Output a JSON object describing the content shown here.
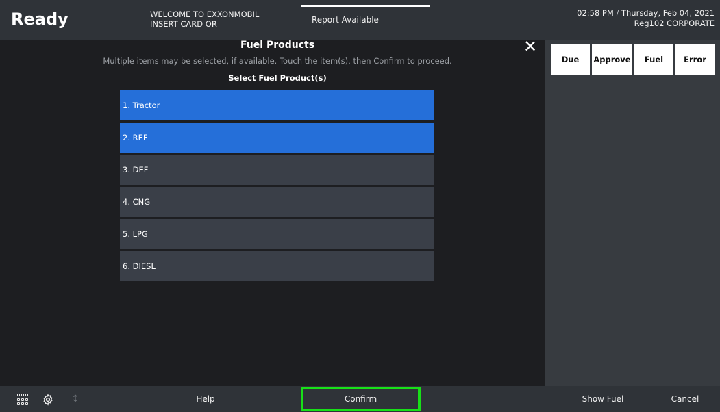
{
  "header": {
    "status": "Ready",
    "welcome_line1": "WELCOME TO EXXONMOBIL",
    "welcome_line2": "INSERT CARD OR",
    "report": "Report Available",
    "time": "02:58 PM",
    "separator": "/",
    "date": "Thursday, Feb 04, 2021",
    "register": "Reg102",
    "store": "CORPORATE"
  },
  "dialog": {
    "title": "Fuel Products",
    "subtitle": "Multiple items may be selected, if available. Touch the item(s), then Confirm to proceed.",
    "list_title": "Select Fuel Product(s)",
    "close_icon": "close-icon",
    "items": [
      {
        "label": "1. Tractor",
        "selected": true
      },
      {
        "label": "2. REF",
        "selected": true
      },
      {
        "label": "3. DEF",
        "selected": false
      },
      {
        "label": "4. CNG",
        "selected": false
      },
      {
        "label": "5. LPG",
        "selected": false
      },
      {
        "label": "6. DIESL",
        "selected": false
      }
    ]
  },
  "right_panel": {
    "tabs": [
      "Due",
      "Approve",
      "Fuel",
      "Error"
    ]
  },
  "footer": {
    "icons": [
      "grid-icon",
      "gear-icon",
      "move-icon"
    ],
    "help": "Help",
    "confirm": "Confirm",
    "show_fuel": "Show Fuel",
    "cancel": "Cancel"
  },
  "colors": {
    "selected": "#256fd9",
    "unselected": "#3a3f48",
    "highlight": "#18e018"
  }
}
